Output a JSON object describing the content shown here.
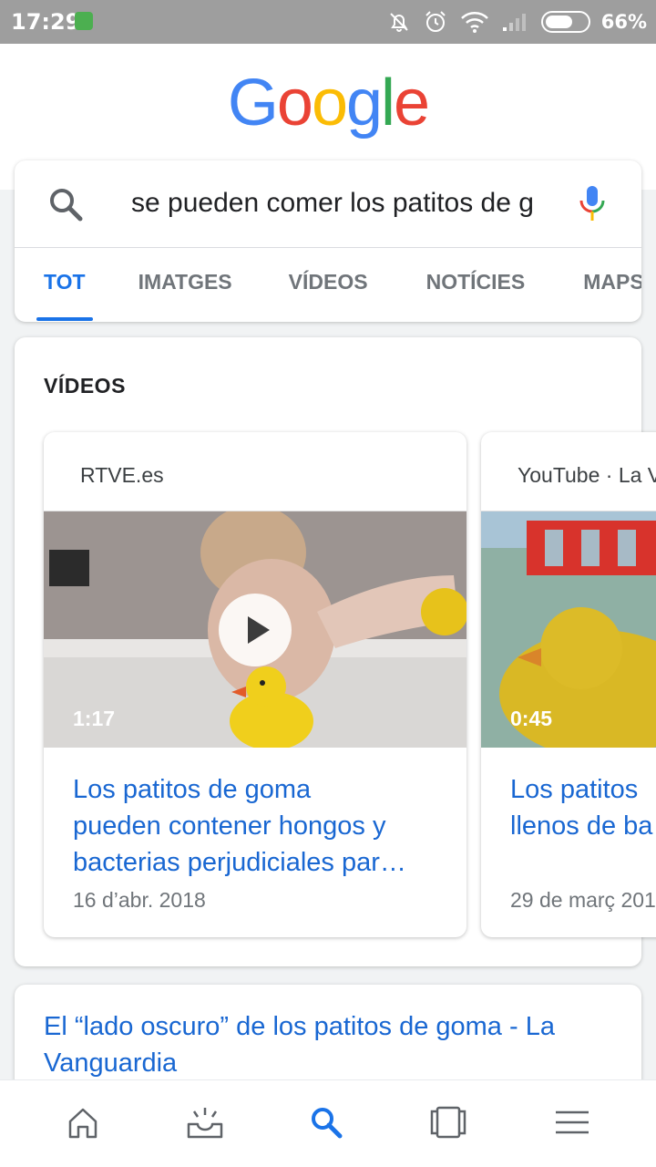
{
  "status_bar": {
    "time": "17:29",
    "battery_percent": "66%",
    "battery_level": 0.66,
    "icons": [
      "app-notification-icon",
      "bell-off-icon",
      "alarm-icon",
      "wifi-icon",
      "signal-icon",
      "battery-icon"
    ]
  },
  "header": {
    "logo_letters": [
      {
        "char": "G",
        "color": "#4285F4"
      },
      {
        "char": "o",
        "color": "#EA4335"
      },
      {
        "char": "o",
        "color": "#FBBC05"
      },
      {
        "char": "g",
        "color": "#4285F4"
      },
      {
        "char": "l",
        "color": "#34A853"
      },
      {
        "char": "e",
        "color": "#EA4335"
      }
    ]
  },
  "search": {
    "query": "se pueden comer los patitos de goma",
    "icons": [
      "search-icon",
      "mic-icon"
    ]
  },
  "tabs": [
    {
      "label": "TOT",
      "active": true
    },
    {
      "label": "IMATGES",
      "active": false
    },
    {
      "label": "VÍDEOS",
      "active": false
    },
    {
      "label": "NOTÍCIES",
      "active": false
    },
    {
      "label": "MAPS",
      "active": false
    }
  ],
  "videos_section": {
    "heading": "VÍDEOS",
    "items": [
      {
        "source": "RTVE.es",
        "duration": "1:17",
        "title_lines": [
          "Los patitos de goma",
          "pueden contener hongos y",
          "bacterias perjudiciales par…"
        ],
        "date": "16 d’abr. 2018"
      },
      {
        "source": "YouTube · La V",
        "duration": "0:45",
        "title_lines": [
          "Los patitos",
          "llenos de ba"
        ],
        "date": "29 de març 201"
      }
    ]
  },
  "result": {
    "title": "El “lado oscuro” de los patitos de goma - La Vanguardia"
  },
  "bottom_nav": {
    "items": [
      {
        "icon": "home-icon",
        "active": false
      },
      {
        "icon": "updates-icon",
        "active": false
      },
      {
        "icon": "search-icon",
        "active": true
      },
      {
        "icon": "tabs-icon",
        "active": false
      },
      {
        "icon": "menu-icon",
        "active": false
      }
    ]
  },
  "colors": {
    "accent": "#1a73e8",
    "link": "#1967d2",
    "status_bar": "#9e9e9e"
  }
}
